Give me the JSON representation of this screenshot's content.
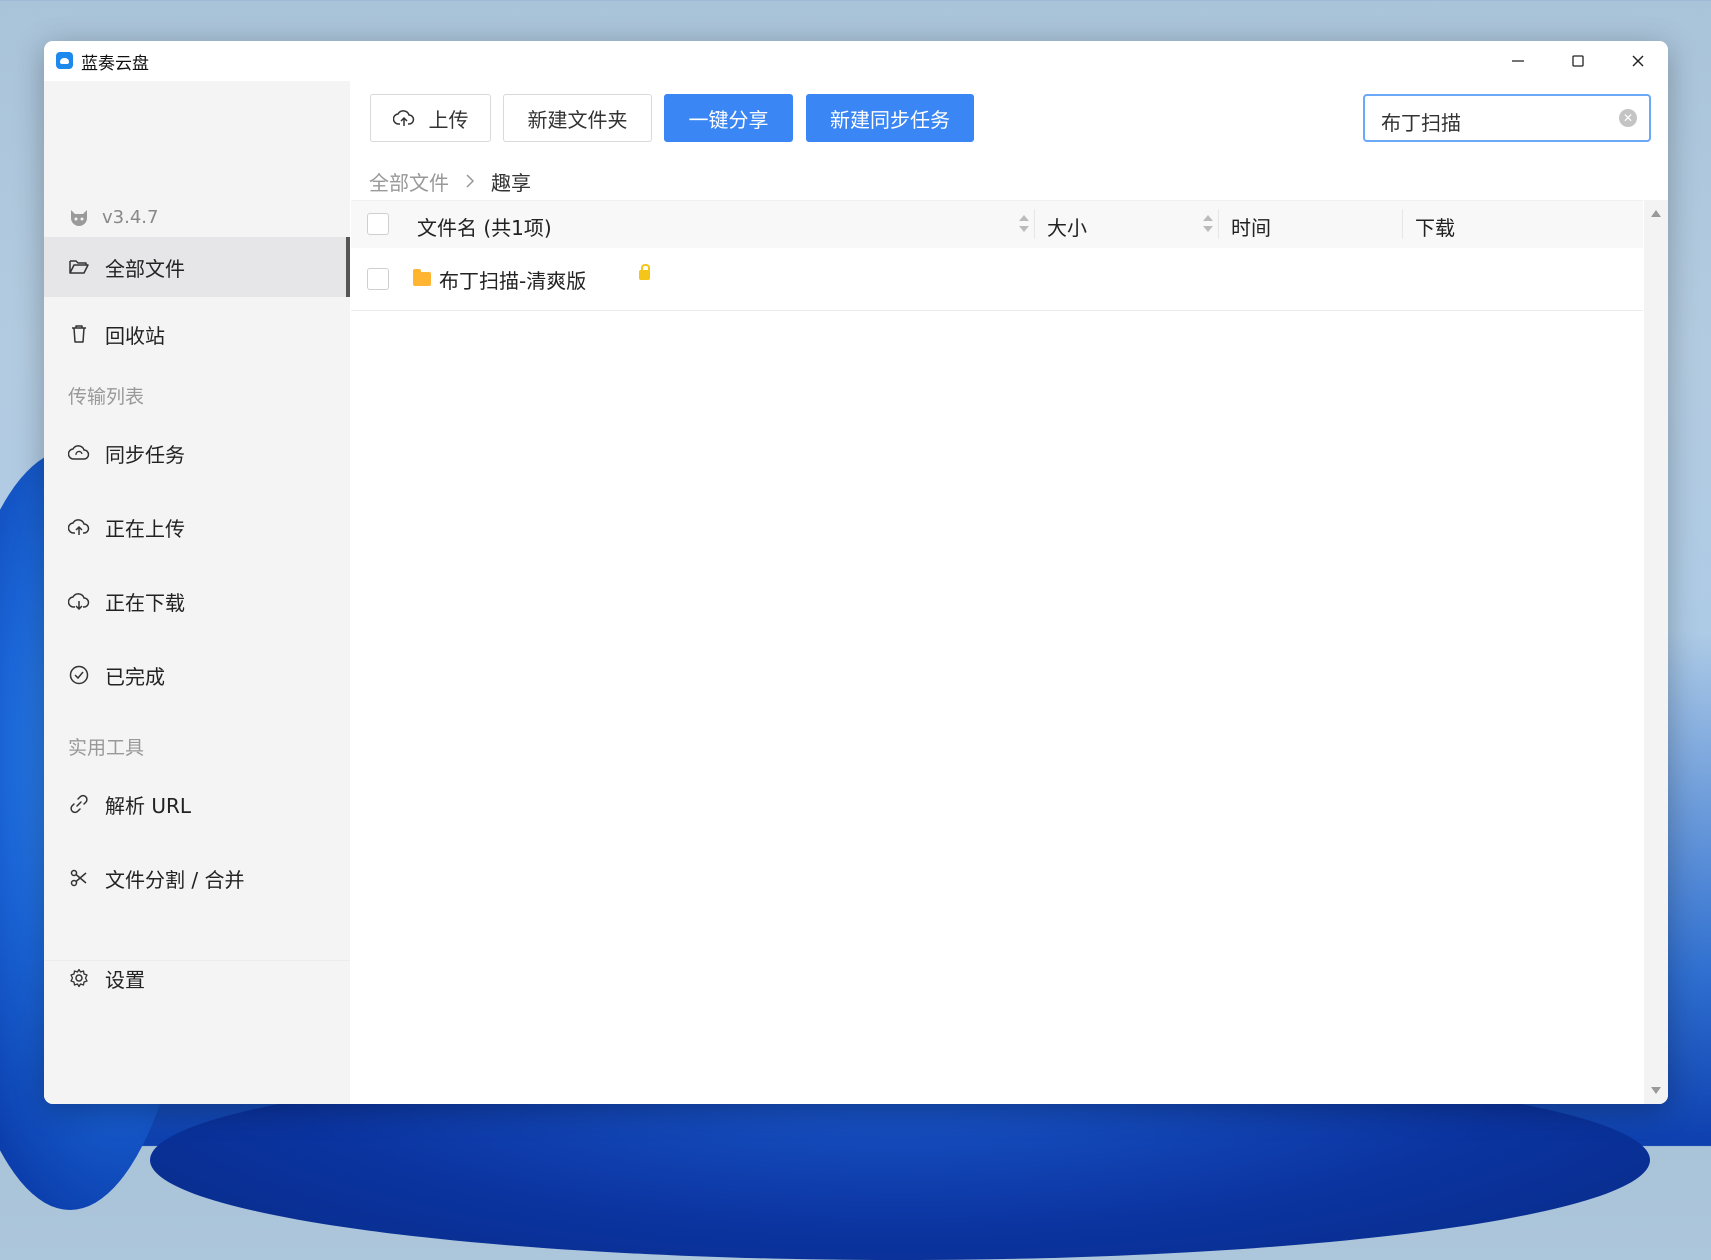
{
  "window": {
    "title": "蓝奏云盘"
  },
  "sidebar": {
    "version": "v3.4.7",
    "items": [
      {
        "label": "全部文件",
        "icon": "folder-open-icon",
        "active": true
      },
      {
        "label": "回收站",
        "icon": "trash-icon"
      }
    ],
    "section_transfer": "传输列表",
    "transfer_items": [
      {
        "label": "同步任务",
        "icon": "cloud-sync-icon"
      },
      {
        "label": "正在上传",
        "icon": "cloud-upload-icon"
      },
      {
        "label": "正在下载",
        "icon": "cloud-download-icon"
      },
      {
        "label": "已完成",
        "icon": "check-circle-icon"
      }
    ],
    "section_tools": "实用工具",
    "tool_items": [
      {
        "label": "解析 URL",
        "icon": "link-icon"
      },
      {
        "label": "文件分割 / 合并",
        "icon": "scissors-icon"
      }
    ],
    "settings": {
      "label": "设置",
      "icon": "gear-icon"
    }
  },
  "toolbar": {
    "upload": "上传",
    "new_folder": "新建文件夹",
    "share": "一键分享",
    "new_sync": "新建同步任务"
  },
  "search": {
    "value": "布丁扫描"
  },
  "breadcrumb": {
    "root": "全部文件",
    "current": "趣享"
  },
  "table": {
    "headers": {
      "name": "文件名 (共1项)",
      "size": "大小",
      "time": "时间",
      "download": "下载"
    },
    "rows": [
      {
        "name": "布丁扫描-清爽版",
        "type": "folder",
        "locked": true
      }
    ]
  },
  "colors": {
    "accent": "#3a86f5",
    "folder": "#ffb531",
    "lock": "#f5c518"
  }
}
